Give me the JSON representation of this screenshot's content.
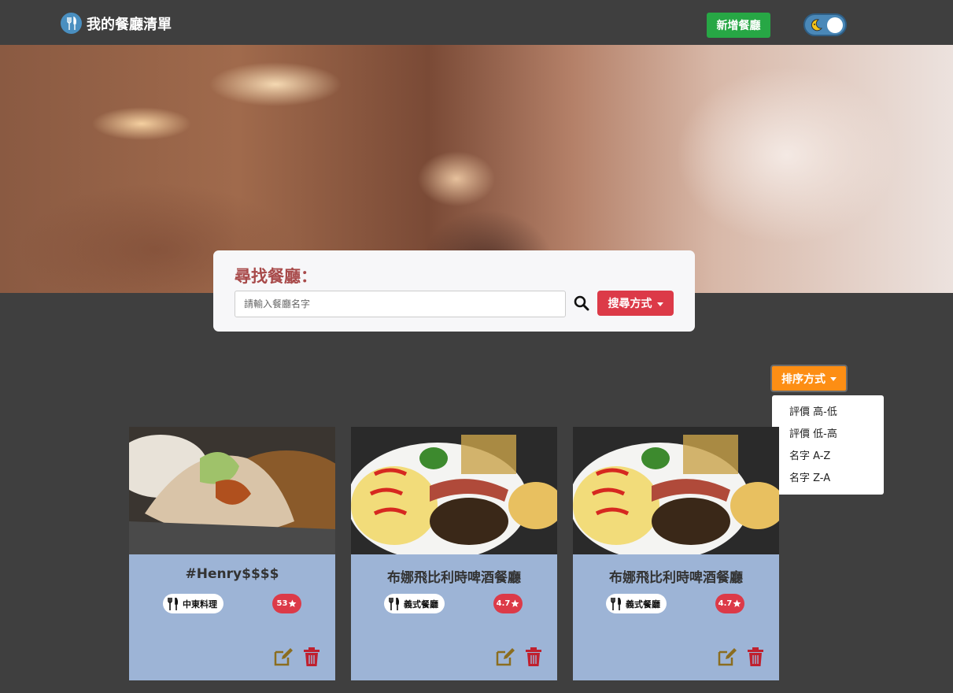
{
  "navbar": {
    "brand": "我的餐廳清單",
    "add_button": "新增餐廳",
    "theme_toggle_icon": "moon-icon"
  },
  "search": {
    "title": "尋找餐廳：",
    "placeholder": "請輸入餐廳名字",
    "mode_button": "搜尋方式"
  },
  "sort": {
    "button": "排序方式",
    "options": [
      "評價 高-低",
      "評價 低-高",
      "名字 A-Z",
      "名字 Z-A"
    ]
  },
  "cards": [
    {
      "name": "#Henry$$$$",
      "category": "中東料理",
      "rating": "53"
    },
    {
      "name": "布娜飛比利時啤酒餐廳",
      "category": "義式餐廳",
      "rating": "4.7"
    },
    {
      "name": "布娜飛比利時啤酒餐廳",
      "category": "義式餐廳",
      "rating": "4.7"
    }
  ],
  "colors": {
    "add_button": "#27a745",
    "search_mode_button": "#dc3a48",
    "sort_button": "#fd8e14",
    "card_body": "#9db4d6",
    "edit_icon": "#8b6d1f",
    "trash_icon": "#c0202e"
  }
}
